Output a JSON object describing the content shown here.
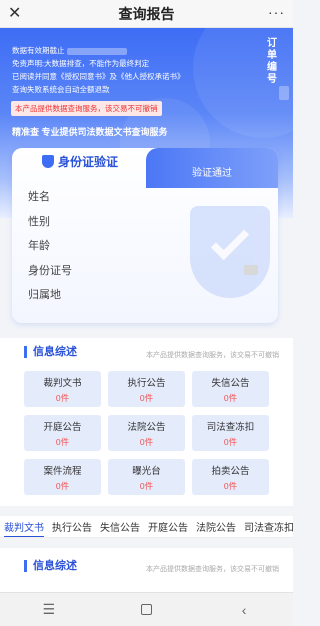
{
  "window": {
    "title": "查询报告",
    "close_icon": "close-icon",
    "more_icon": "more-icon",
    "more_glyph": "···"
  },
  "hero": {
    "notice_lines": [
      "数据有效期截止",
      "免责声明:大数据排查，不能作为最终判定",
      "已阅读并同意《授权同意书》及《他人授权承诺书》",
      "查询失败系统会自动全额退款"
    ],
    "warning": "本产品提供数据查询服务，该交易不可撤销",
    "service": "精准查  专业提供司法数据文书查询服务",
    "side_tag": "订单编号"
  },
  "id_card": {
    "title": "身份证验证",
    "status": "验证通过",
    "fields": [
      "姓名",
      "性别",
      "年龄",
      "身份证号",
      "归属地"
    ]
  },
  "summary": {
    "title": "信息综述",
    "note": "本产品提供数据查询服务，该交易不可撤销",
    "items": [
      {
        "name": "裁判文书",
        "count": "0件"
      },
      {
        "name": "执行公告",
        "count": "0件"
      },
      {
        "name": "失信公告",
        "count": "0件"
      },
      {
        "name": "开庭公告",
        "count": "0件"
      },
      {
        "name": "法院公告",
        "count": "0件"
      },
      {
        "name": "司法查冻扣",
        "count": "0件"
      },
      {
        "name": "案件流程",
        "count": "0件"
      },
      {
        "name": "曝光台",
        "count": "0件"
      },
      {
        "name": "拍卖公告",
        "count": "0件"
      }
    ]
  },
  "tabs": [
    "裁判文书",
    "执行公告",
    "失信公告",
    "开庭公告",
    "法院公告",
    "司法查冻扣"
  ],
  "summary2": {
    "title": "信息综述",
    "note": "本产品提供数据查询服务，该交易不可撤销"
  },
  "navbar": {
    "menu_glyph": "☰",
    "back_glyph": "‹"
  },
  "colors": {
    "accent": "#3e6df5",
    "warn": "#e33333",
    "count": "#ee5555"
  }
}
